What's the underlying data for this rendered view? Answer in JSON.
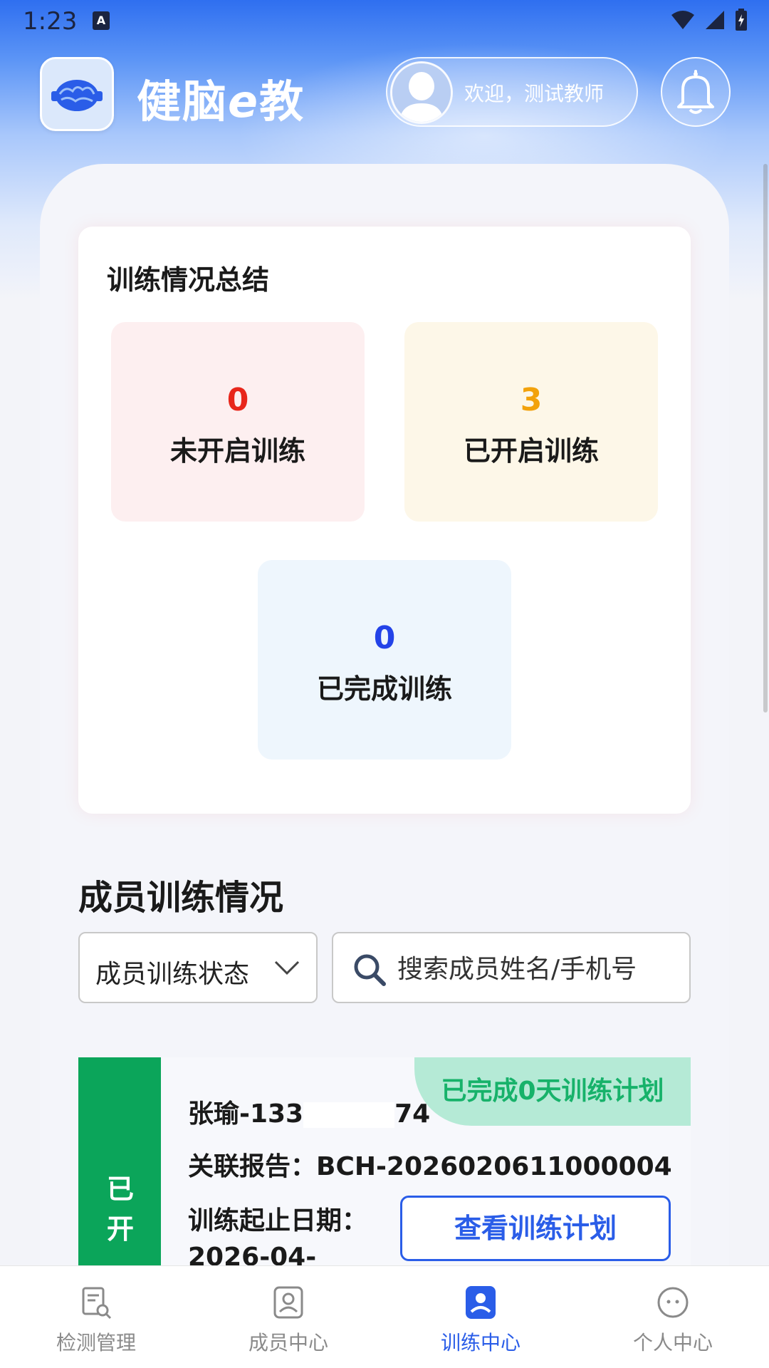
{
  "status_bar": {
    "time": "1:23",
    "notif_letter": "A"
  },
  "header": {
    "app_title_a": "健脑",
    "app_title_e": "e",
    "app_title_b": "教",
    "welcome": "欢迎，测试教师"
  },
  "summary": {
    "title": "训练情况总结",
    "stats": [
      {
        "value": "0",
        "label": "未开启训练",
        "color": "#e8261b",
        "bg": "#fdeff0"
      },
      {
        "value": "3",
        "label": "已开启训练",
        "color": "#f2a20c",
        "bg": "#fdf7e8"
      },
      {
        "value": "0",
        "label": "已完成训练",
        "color": "#2343e8",
        "bg": "#eef6fd"
      }
    ]
  },
  "members": {
    "title": "成员训练情况",
    "filter_label": "成员训练状态",
    "search_placeholder": "搜索成员姓名/手机号",
    "rows": [
      {
        "status_char1": "已",
        "status_char2": "开",
        "badge": "已完成0天训练计划",
        "name_prefix": "张瑜-133",
        "name_suffix": "74",
        "report": "关联报告：BCH-2026020611000004",
        "date_label": "训练起止日期：",
        "date_value": "2026-04-",
        "action": "查看训练计划"
      }
    ]
  },
  "nav": {
    "items": [
      {
        "label": "检测管理",
        "icon": "report-search-icon",
        "active": false
      },
      {
        "label": "成员中心",
        "icon": "member-badge-icon",
        "active": false
      },
      {
        "label": "训练中心",
        "icon": "training-user-icon",
        "active": true
      },
      {
        "label": "个人中心",
        "icon": "face-circle-icon",
        "active": false
      }
    ]
  },
  "colors": {
    "accent": "#2a5de8",
    "green": "#0ba55a"
  }
}
